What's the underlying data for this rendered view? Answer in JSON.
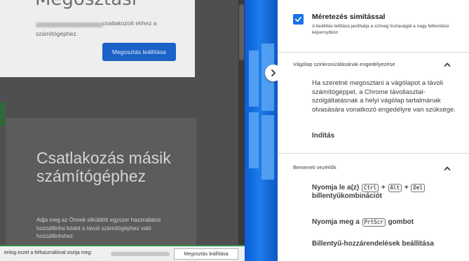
{
  "left_page": {
    "share_heading": "Megosztási",
    "connected_msg_line1": "csatlakozott ehhez a",
    "connected_msg_line2": "számítógéphez.",
    "stop_sharing_button": "Megosztás leállítása",
    "connect_title": "Csatlakozás másik számítógéphez",
    "connect_desc": "Adja meg az Önnek elküldött egyszer használatos hozzáférési kódot a távoli számítógéphez való hozzáféréshez."
  },
  "share_bar": {
    "text": "enlog ezzel a felhasználóval osztja meg:",
    "stop_button": "Megosztás leállítása"
  },
  "side_panel": {
    "smoothing": {
      "title": "Méretezés simítással",
      "description": "A beállítás letiltása javíthatja a szöveg tisztaságát a nagy felbontású képernyőkön",
      "checked": true
    },
    "clipboard": {
      "title": "Vágólap szinkronizálásának engedélyezése",
      "text": "Ha szeretné megosztani a vágólapot a távoli számítógéppel, a Chrome távoliasztal-szolgáltatásnak a helyi vágólap tartalmának olvasására vonatkozó engedélyre van szüksége.",
      "start_link": "Indítás"
    },
    "input_controls": {
      "title": "Bemeneti vezérlők",
      "press_prefix": "Nyomja le a(z)",
      "plus": "+",
      "keys": [
        "Ctrl",
        "Alt",
        "Del"
      ],
      "combo_suffix": "billentyűkombinációt",
      "press2_prefix": "Nyomja meg a",
      "prtscr_key": "PrtScr",
      "press2_suffix": "gombot",
      "keymap_settings": "Billentyű-hozzárendelések beállítása"
    }
  },
  "colors": {
    "accent_blue": "#1a73e8",
    "share_green": "#2e8b48"
  }
}
